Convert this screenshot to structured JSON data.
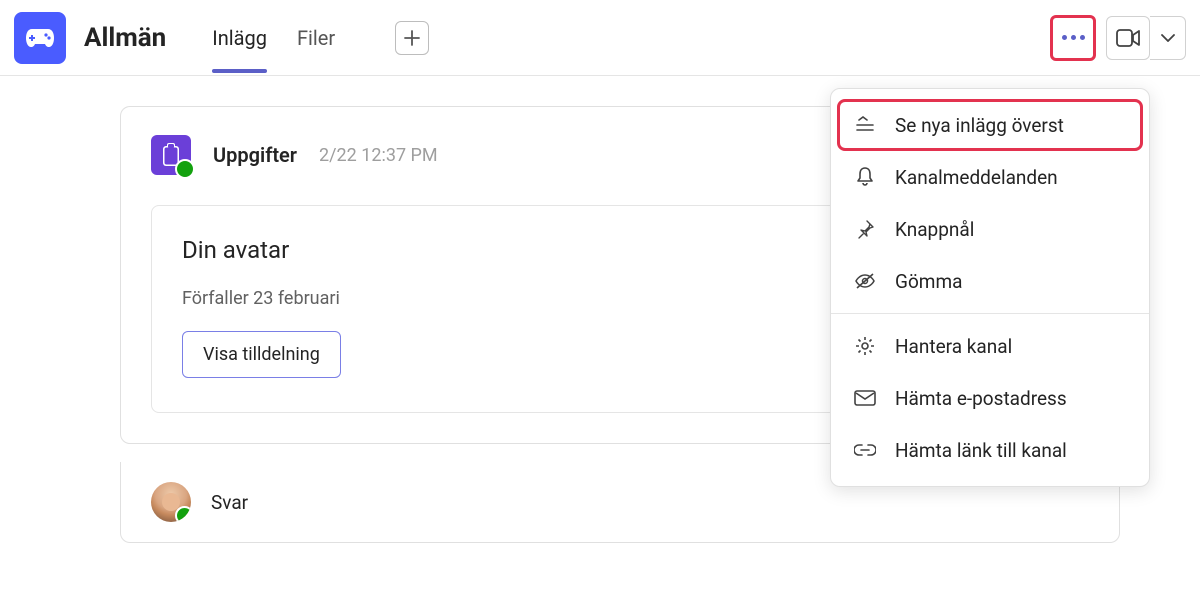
{
  "header": {
    "channel_name": "Allmän",
    "tabs": [
      {
        "label": "Inlägg",
        "active": true
      },
      {
        "label": "Filer",
        "active": false
      }
    ]
  },
  "menu": {
    "items": [
      {
        "icon": "sort",
        "label": "Se nya inlägg överst",
        "highlight": true
      },
      {
        "icon": "bell",
        "label": "Kanalmeddelanden"
      },
      {
        "icon": "pin",
        "label": "Knappnål"
      },
      {
        "icon": "eye-off",
        "label": "Gömma"
      },
      {
        "sep": true
      },
      {
        "icon": "gear",
        "label": "Hantera kanal"
      },
      {
        "icon": "mail",
        "label": "Hämta e-postadress"
      },
      {
        "icon": "link",
        "label": "Hämta länk till kanal"
      }
    ]
  },
  "post": {
    "sender": "Uppgifter",
    "timestamp": "2/22 12:37 PM",
    "card": {
      "title": "Din avatar",
      "due": "Förfaller 23 februari",
      "button": "Visa tilldelning"
    }
  },
  "reply_label": "Svar"
}
